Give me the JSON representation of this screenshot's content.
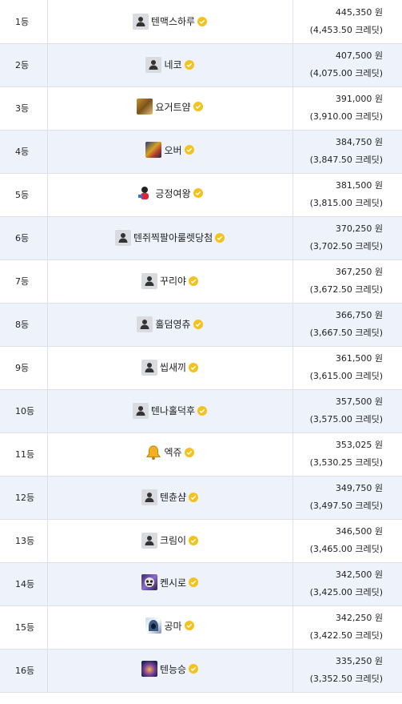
{
  "colors": {
    "row_alt_bg": "#eef2fb",
    "border": "#dde1ea",
    "verified_badge": "#f4c21c"
  },
  "rows": [
    {
      "rank": "1등",
      "name": "텐맥스하루",
      "avatar": "default-avatar-icon",
      "amount": "445,350 원",
      "credit": "(4,453.50 크레딧)"
    },
    {
      "rank": "2등",
      "name": "네코",
      "avatar": "default-avatar-icon",
      "amount": "407,500 원",
      "credit": "(4,075.00 크레딧)"
    },
    {
      "rank": "3등",
      "name": "요거트얌",
      "avatar": "profile-image",
      "amount": "391,000 원",
      "credit": "(3,910.00 크레딧)"
    },
    {
      "rank": "4등",
      "name": "오버",
      "avatar": "profile-image",
      "amount": "384,750 원",
      "credit": "(3,847.50 크레딧)"
    },
    {
      "rank": "5등",
      "name": "긍정여왕",
      "avatar": "profile-image",
      "amount": "381,500 원",
      "credit": "(3,815.00 크레딧)"
    },
    {
      "rank": "6등",
      "name": "텐쥐찍팔아룰렛당첨",
      "avatar": "default-avatar-icon",
      "amount": "370,250 원",
      "credit": "(3,702.50 크레딧)"
    },
    {
      "rank": "7등",
      "name": "꾸리야",
      "avatar": "default-avatar-icon",
      "amount": "367,250 원",
      "credit": "(3,672.50 크레딧)"
    },
    {
      "rank": "8등",
      "name": "훌덤영츄",
      "avatar": "default-avatar-icon",
      "amount": "366,750 원",
      "credit": "(3,667.50 크레딧)"
    },
    {
      "rank": "9등",
      "name": "씹새끼",
      "avatar": "default-avatar-icon",
      "amount": "361,500 원",
      "credit": "(3,615.00 크레딧)"
    },
    {
      "rank": "10등",
      "name": "텐나홀덕후",
      "avatar": "default-avatar-icon",
      "amount": "357,500 원",
      "credit": "(3,575.00 크레딧)"
    },
    {
      "rank": "11등",
      "name": "엑쥬",
      "avatar": "bell-icon",
      "amount": "353,025 원",
      "credit": "(3,530.25 크레딧)"
    },
    {
      "rank": "12등",
      "name": "텐츈샴",
      "avatar": "default-avatar-icon",
      "amount": "349,750 원",
      "credit": "(3,497.50 크레딧)"
    },
    {
      "rank": "13등",
      "name": "크림이",
      "avatar": "default-avatar-icon",
      "amount": "346,500 원",
      "credit": "(3,465.00 크레딧)"
    },
    {
      "rank": "14등",
      "name": "켄시로",
      "avatar": "profile-image",
      "amount": "342,500 원",
      "credit": "(3,425.00 크레딧)"
    },
    {
      "rank": "15등",
      "name": "공마",
      "avatar": "profile-image",
      "amount": "342,250 원",
      "credit": "(3,422.50 크레딧)"
    },
    {
      "rank": "16등",
      "name": "텐능승",
      "avatar": "profile-image",
      "amount": "335,250 원",
      "credit": "(3,352.50 크레딧)"
    }
  ]
}
